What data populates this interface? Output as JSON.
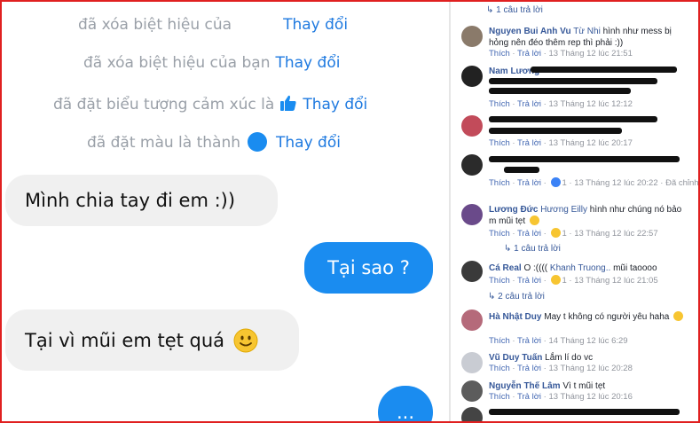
{
  "chat": {
    "notice_1": "đã xóa biệt hiệu của",
    "notice_2": "đã xóa biệt hiệu của bạn",
    "notice_3": "đã đặt biểu tượng cảm xúc là",
    "notice_4": "đã đặt màu là thành",
    "change_link": "Thay đổi",
    "messages": [
      {
        "side": "in",
        "text": "Mình chia tay đi em :))"
      },
      {
        "side": "out",
        "text": "Tại sao ?"
      },
      {
        "side": "in",
        "text": "Tại vì mũi em tẹt quá",
        "emoji": "slight-smile"
      },
      {
        "side": "out",
        "text": "..."
      }
    ],
    "accent_color": "#1a8cf0",
    "icons": [
      "thumbs-up-icon",
      "color-dot-icon",
      "smiley-icon"
    ]
  },
  "comments": {
    "like_label": "Thích",
    "reply_label": "Trả lời",
    "top_replies": "1 câu trả lời",
    "items": [
      {
        "name": "Nguyen Bui Anh Vu",
        "mention": "Từ Nhi",
        "text": "hình như mess bị hỏng nên đéo thêm rep thì phải :))",
        "time": "13 Tháng 12 lúc 21:51"
      },
      {
        "name": "Nam Lương",
        "text": "",
        "time": "13 Tháng 12 lúc 12:12"
      },
      {
        "name": "",
        "text": "",
        "time": "13 Tháng 12 lúc 20:17"
      },
      {
        "name": "",
        "text": "",
        "reactions": "1",
        "time": "13 Tháng 12 lúc 20:22",
        "edited": "Đã chỉnh sửa"
      },
      {
        "name": "Lương Đức",
        "mention": "Hương Eilly",
        "text": "hình như chúng nó bảo m mũi tẹt",
        "reactions": "1",
        "time": "13 Tháng 12 lúc 22:57",
        "replies": "1 câu trả lời"
      },
      {
        "name": "Cá Real",
        "mention": "Khanh Truong..",
        "text": "mũi taoooo",
        "prefix": "O :((((",
        "reactions": "1",
        "time": "13 Tháng 12 lúc 21:05",
        "replies": "2 câu trả lời"
      },
      {
        "name": "Hà Nhật Duy",
        "text": "May t không có người yêu haha",
        "time": "14 Tháng 12 lúc 6:29"
      },
      {
        "name": "Vũ Duy Tuấn",
        "text": "Lắm lí do vc",
        "time": "13 Tháng 12 lúc 20:28"
      },
      {
        "name": "Nguyễn Thế Lâm",
        "text": "Vì t mũi tẹt",
        "time": "13 Tháng 12 lúc 20:16"
      }
    ]
  }
}
